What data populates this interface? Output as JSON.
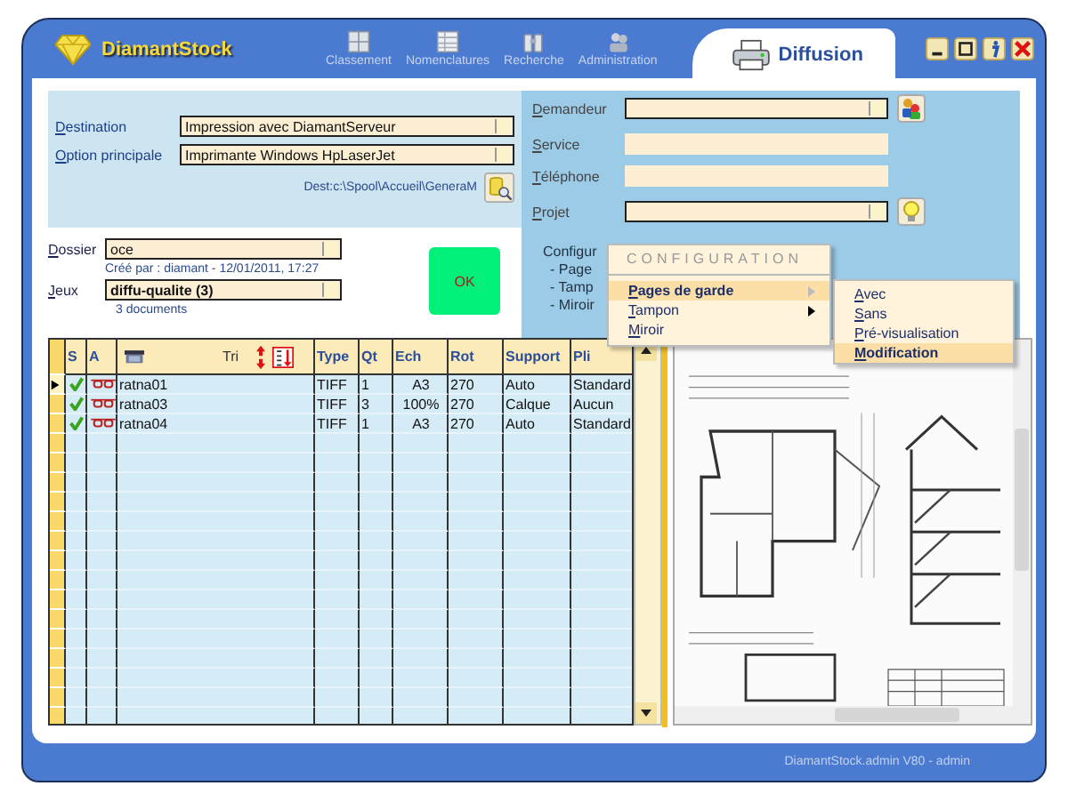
{
  "app": {
    "name": "DiamantStock"
  },
  "nav": [
    {
      "label": "Classement",
      "kind": "cabinet"
    },
    {
      "label": "Nomenclatures",
      "kind": "grid"
    },
    {
      "label": "Recherche",
      "kind": "binoculars"
    },
    {
      "label": "Administration",
      "kind": "people"
    }
  ],
  "module": {
    "label": "Diffusion"
  },
  "destination": {
    "label": "Destination",
    "value": "Impression avec DiamantServeur"
  },
  "option": {
    "label": "Option principale",
    "value": "Imprimante Windows HpLaserJet"
  },
  "dest_path": "Dest:c:\\Spool\\Accueil\\GeneraM",
  "demandeur": {
    "label": "Demandeur"
  },
  "service": {
    "label": "Service"
  },
  "telephone": {
    "label": "Téléphone"
  },
  "projet": {
    "label": "Projet"
  },
  "config_lines": [
    "Configur",
    "- Page",
    "- Tamp",
    "- Miroir"
  ],
  "dossier": {
    "label": "Dossier",
    "value": "oce",
    "created": "Créé par : diamant - 12/01/2011, 17:27"
  },
  "ok_button": "OK",
  "jeux": {
    "label": "Jeux",
    "value": "diffu-qualite (3)"
  },
  "doc_count": "3 documents",
  "table": {
    "columns": [
      "S",
      "A",
      "Tri",
      "Type",
      "Qt",
      "Ech",
      "Rot",
      "Support",
      "Pli"
    ],
    "rows": [
      {
        "selected": true,
        "validated": true,
        "name": "ratna01",
        "type": "TIFF",
        "qt": "1",
        "ech": "A3",
        "rot": "270",
        "support": "Auto",
        "pli": "Standard"
      },
      {
        "selected": false,
        "validated": true,
        "name": "ratna03",
        "type": "TIFF",
        "qt": "3",
        "ech": "100%",
        "rot": "270",
        "support": "Calque",
        "pli": "Aucun"
      },
      {
        "selected": false,
        "validated": true,
        "name": "ratna04",
        "type": "TIFF",
        "qt": "1",
        "ech": "A3",
        "rot": "270",
        "support": "Auto",
        "pli": "Standard"
      }
    ]
  },
  "menu": {
    "title": "CONFIGURATION",
    "items": [
      {
        "label": "Pages de garde",
        "selected": true,
        "submenu": true
      },
      {
        "label": "Tampon",
        "selected": false,
        "submenu": true
      },
      {
        "label": "Miroir",
        "selected": false,
        "submenu": false
      }
    ]
  },
  "submenu": {
    "items": [
      {
        "label": "Avec",
        "selected": false
      },
      {
        "label": "Sans",
        "selected": false
      },
      {
        "label": "Pré-visualisation",
        "selected": false
      },
      {
        "label": "Modification",
        "selected": true
      }
    ]
  },
  "status_bar": "DiamantStock.admin V80 - admin"
}
